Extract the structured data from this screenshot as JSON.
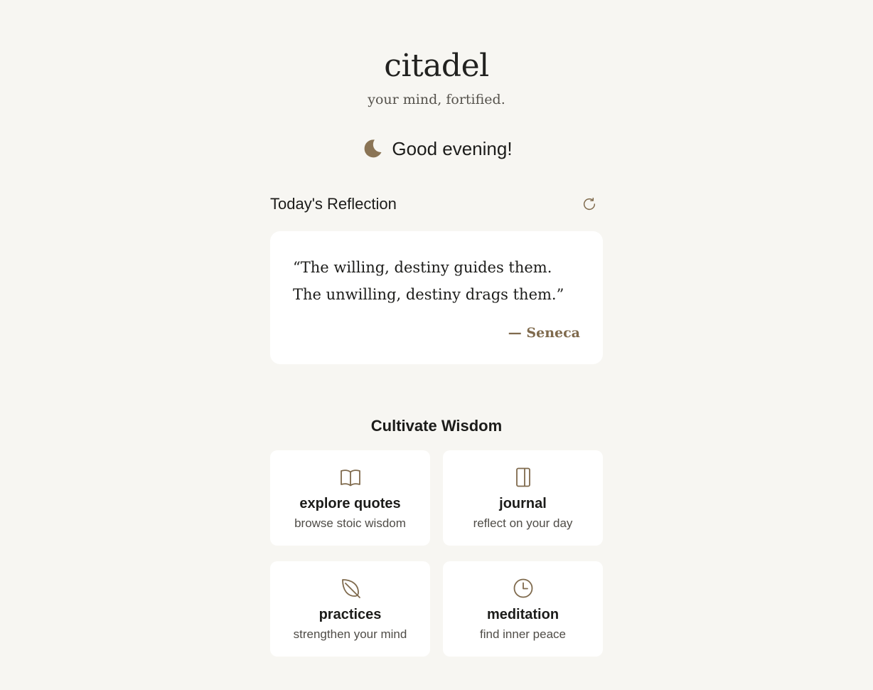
{
  "header": {
    "title": "citadel",
    "tagline": "your mind, fortified."
  },
  "greeting": {
    "icon": "moon-icon",
    "text": "Good evening!"
  },
  "reflection": {
    "title": "Today's Reflection",
    "refresh_icon": "refresh-icon",
    "quote": "“The willing, destiny guides them. The unwilling, destiny drags them.”",
    "author": "— Seneca"
  },
  "wisdom": {
    "title": "Cultivate Wisdom",
    "tiles": [
      {
        "icon": "book-open-icon",
        "title": "explore quotes",
        "subtitle": "browse stoic wisdom"
      },
      {
        "icon": "journal-icon",
        "title": "journal",
        "subtitle": "reflect on your day"
      },
      {
        "icon": "leaf-icon",
        "title": "practices",
        "subtitle": "strengthen your mind"
      },
      {
        "icon": "clock-icon",
        "title": "meditation",
        "subtitle": "find inner peace"
      }
    ]
  },
  "colors": {
    "background": "#f7f6f2",
    "card": "#ffffff",
    "accent": "#7f6a4d",
    "text": "#1c1c1a"
  }
}
